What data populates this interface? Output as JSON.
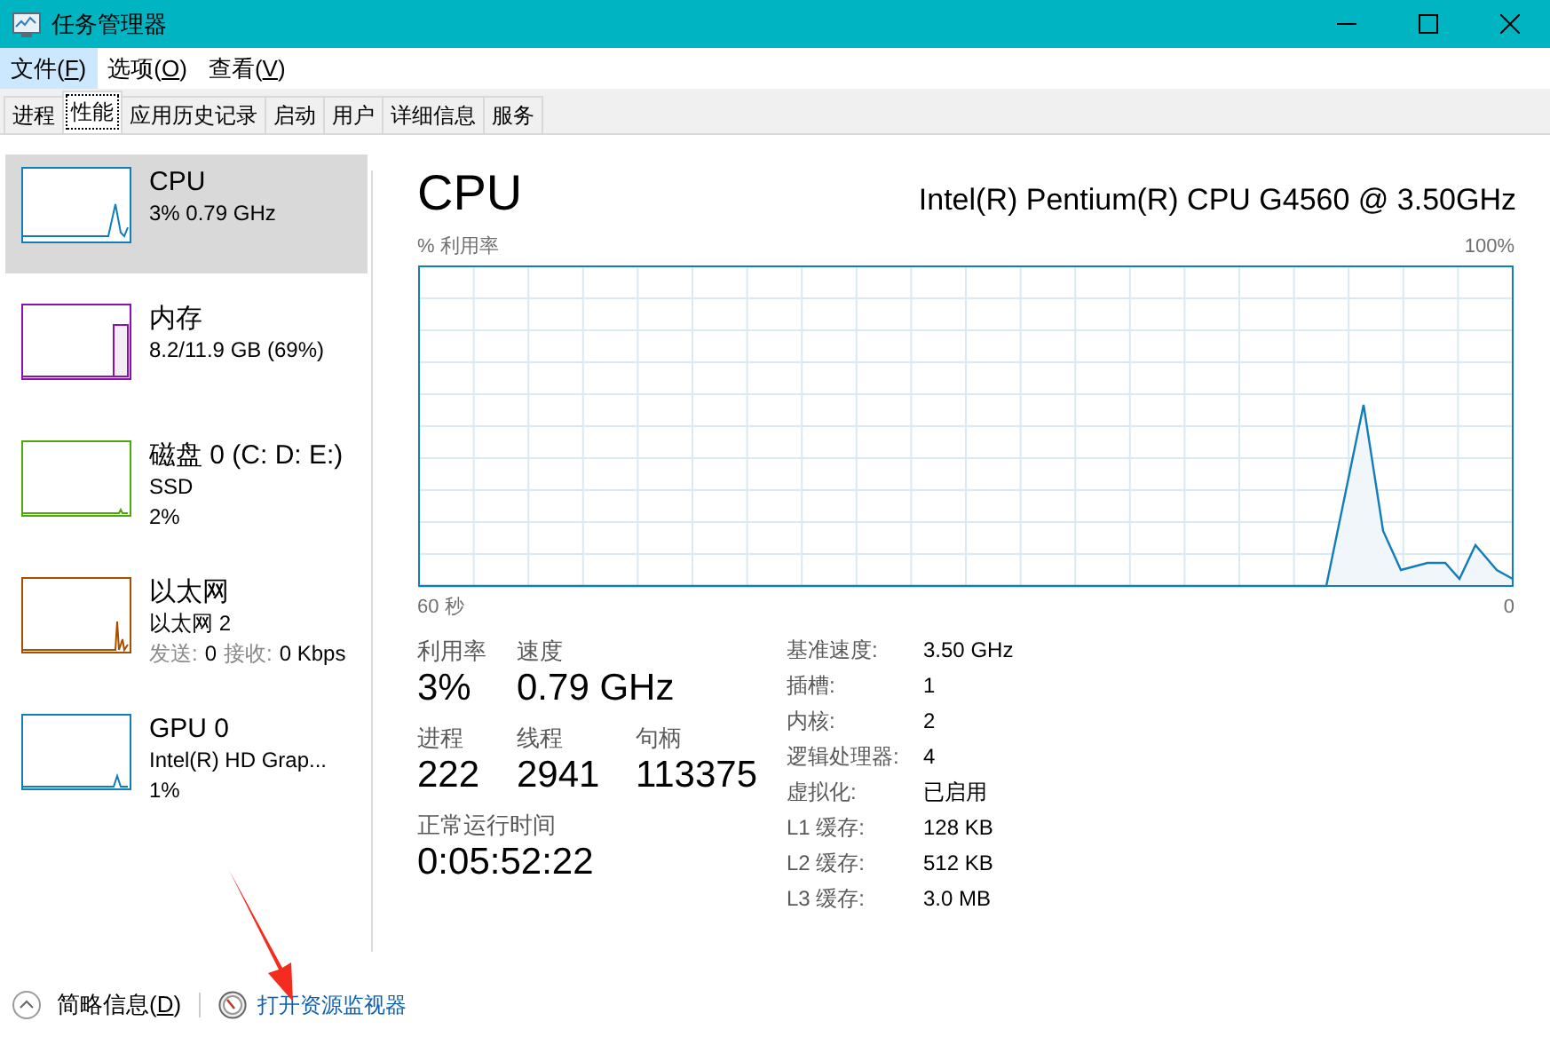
{
  "window": {
    "title": "任务管理器"
  },
  "menu": [
    {
      "before": "文件(",
      "key": "F",
      "after": ")",
      "selected": true
    },
    {
      "before": "选项(",
      "key": "O",
      "after": ")",
      "selected": false
    },
    {
      "before": "查看(",
      "key": "V",
      "after": ")",
      "selected": false
    }
  ],
  "tabs": [
    {
      "label": "进程",
      "selected": false
    },
    {
      "label": "性能",
      "selected": true
    },
    {
      "label": "应用历史记录",
      "selected": false
    },
    {
      "label": "启动",
      "selected": false
    },
    {
      "label": "用户",
      "selected": false
    },
    {
      "label": "详细信息",
      "selected": false
    },
    {
      "label": "服务",
      "selected": false
    }
  ],
  "sidebar": {
    "items": [
      {
        "kind": "cpu",
        "name": "CPU",
        "details": [
          "3% 0.79 GHz"
        ],
        "color": "#117dbb",
        "selected": true
      },
      {
        "kind": "memory",
        "name": "内存",
        "details": [
          "8.2/11.9 GB (69%)"
        ],
        "color": "#8b12ae",
        "selected": false
      },
      {
        "kind": "disk",
        "name": "磁盘 0 (C: D: E:)",
        "details": [
          "SSD",
          "2%"
        ],
        "color": "#4da60c",
        "selected": false
      },
      {
        "kind": "network",
        "name": "以太网",
        "details": [
          "以太网 2"
        ],
        "traffic": [
          {
            "label": "发送:",
            "value": "0"
          },
          {
            "label": "接收:",
            "value": "0 Kbps"
          }
        ],
        "color": "#a74f01",
        "selected": false
      },
      {
        "kind": "gpu",
        "name": "GPU 0",
        "details": [
          "Intel(R) HD Grap...",
          "1%"
        ],
        "color": "#117dbb",
        "selected": false
      }
    ]
  },
  "panel": {
    "title": "CPU",
    "model": "Intel(R) Pentium(R) CPU G4560 @ 3.50GHz",
    "graph": {
      "axis_title": "% 利用率",
      "max_label": "100%",
      "start_label": "60 秒",
      "end_label": "0"
    },
    "stats": [
      [
        {
          "label": "利用率",
          "value": "3%"
        },
        {
          "label": "速度",
          "value": "0.79 GHz"
        }
      ],
      [
        {
          "label": "进程",
          "value": "222"
        },
        {
          "label": "线程",
          "value": "2941"
        },
        {
          "label": "句柄",
          "value": "113375"
        }
      ],
      [
        {
          "label": "正常运行时间",
          "value": "0:05:52:22"
        }
      ]
    ],
    "specs": [
      {
        "label": "基准速度:",
        "value": "3.50 GHz"
      },
      {
        "label": "插槽:",
        "value": "1"
      },
      {
        "label": "内核:",
        "value": "2"
      },
      {
        "label": "逻辑处理器:",
        "value": "4"
      },
      {
        "label": "虚拟化:",
        "value": "已启用"
      },
      {
        "label": "L1 缓存:",
        "value": "128 KB"
      },
      {
        "label": "L2 缓存:",
        "value": "512 KB"
      },
      {
        "label": "L3 缓存:",
        "value": "3.0 MB"
      }
    ]
  },
  "footer": {
    "summary": {
      "before": "简略信息(",
      "key": "D",
      "after": ")"
    },
    "link": "打开资源监视器"
  }
}
